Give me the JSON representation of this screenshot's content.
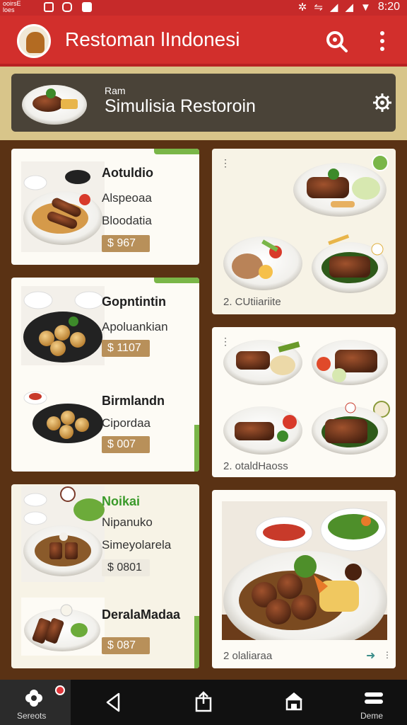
{
  "status_bar": {
    "left_text": "ooirsE loes",
    "time": "8:20"
  },
  "app_bar": {
    "title": "Restoman lIndonesi",
    "logo_icon": "restaurant-logo-icon",
    "search_icon": "search-icon",
    "menu_icon": "more-vert-icon"
  },
  "header": {
    "small": "Ram",
    "title": "Simulisia Restoroin"
  },
  "menu_items": [
    {
      "name": "Aotuldio",
      "desc": "Alspeoaa",
      "desc2": "Bloodatia",
      "price": "$ 967"
    },
    {
      "name": "Gopntintin",
      "desc": "Apoluankian",
      "price": "$ 1107"
    },
    {
      "name": "Birmlandn",
      "desc": "Cipordaa",
      "price": "$ 007"
    },
    {
      "name": "Noikai",
      "desc": "Nipanuko",
      "desc2": "Simeyolarela",
      "price": "$ 0801"
    },
    {
      "name": "DeralaMadaa",
      "price": "$ 087"
    }
  ],
  "gallery": [
    {
      "caption": "2. CUtiiariite"
    },
    {
      "caption": "2. otaldHaoss"
    },
    {
      "caption": "2 olaliaraa"
    }
  ],
  "bottom_nav": {
    "first_label": "Sereots",
    "last_label": "Deme"
  },
  "colors": {
    "app_bar": "#d22f2c",
    "gold_band": "#d8c58a",
    "background": "#5a3214",
    "price_tag": "#b8905a",
    "accent_green": "#7ab648"
  }
}
